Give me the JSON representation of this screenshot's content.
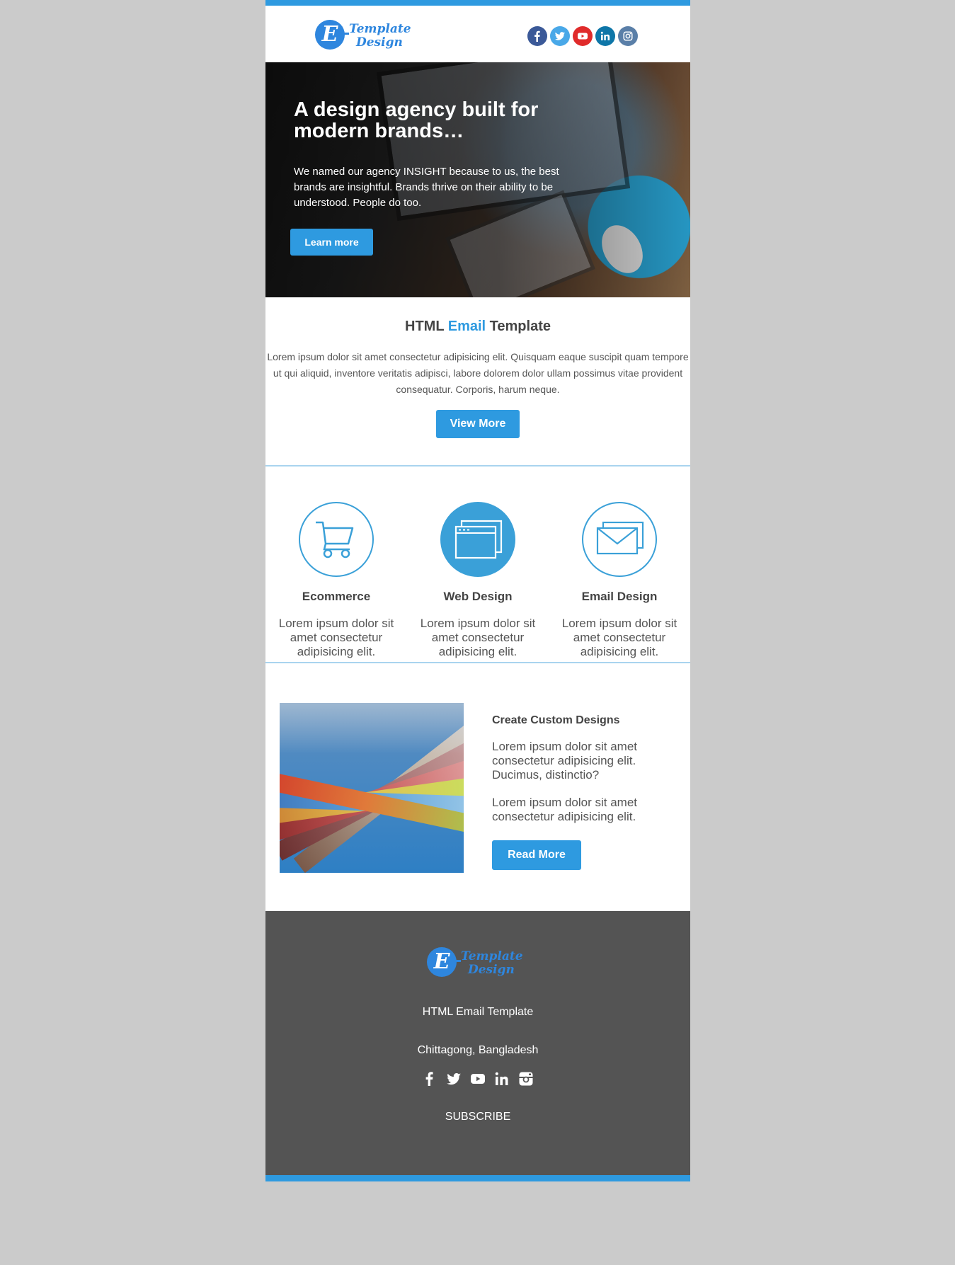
{
  "colors": {
    "accent": "#2e9ae0",
    "background": "#cbcbcb",
    "footer_background": "#545454",
    "icon_blue": "#3aa0d8"
  },
  "logo": {
    "letter": "E",
    "line1": "Template",
    "line2": "Design"
  },
  "social": [
    "facebook-icon",
    "twitter-icon",
    "youtube-icon",
    "linkedin-icon",
    "instagram-icon"
  ],
  "hero": {
    "title": "A design agency built for modern brands…",
    "text": "We named our agency INSIGHT because to us, the best brands are insightful. Brands thrive on their ability to be understood. People do too.",
    "button": "Learn more"
  },
  "intro": {
    "title_pre": "HTML",
    "title_accent": "Email",
    "title_post": "Template",
    "text": "Lorem ipsum dolor sit amet consectetur adipisicing elit. Quisquam eaque suscipit quam tempore ut qui aliquid, inventore veritatis adipisci, labore dolorem dolor ullam possimus vitae provident consequatur. Corporis, harum neque.",
    "button": "View More"
  },
  "features": [
    {
      "icon": "shopping-cart-icon",
      "title": "Ecommerce",
      "text": "Lorem ipsum dolor sit amet consectetur adipisicing elit."
    },
    {
      "icon": "browser-windows-icon",
      "title": "Web Design",
      "text": "Lorem ipsum dolor sit amet consectetur adipisicing elit."
    },
    {
      "icon": "envelope-icon",
      "title": "Email Design",
      "text": "Lorem ipsum dolor sit amet consectetur adipisicing elit."
    }
  ],
  "custom": {
    "title": "Create Custom Designs",
    "text1": "Lorem ipsum dolor sit amet consectetur adipisicing elit. Ducimus, distinctio?",
    "text2": "Lorem ipsum dolor sit amet consectetur adipisicing elit.",
    "button": "Read More"
  },
  "footer": {
    "tagline": "HTML Email Template",
    "location": "Chittagong, Bangladesh",
    "subscribe": "SUBSCRIBE"
  }
}
